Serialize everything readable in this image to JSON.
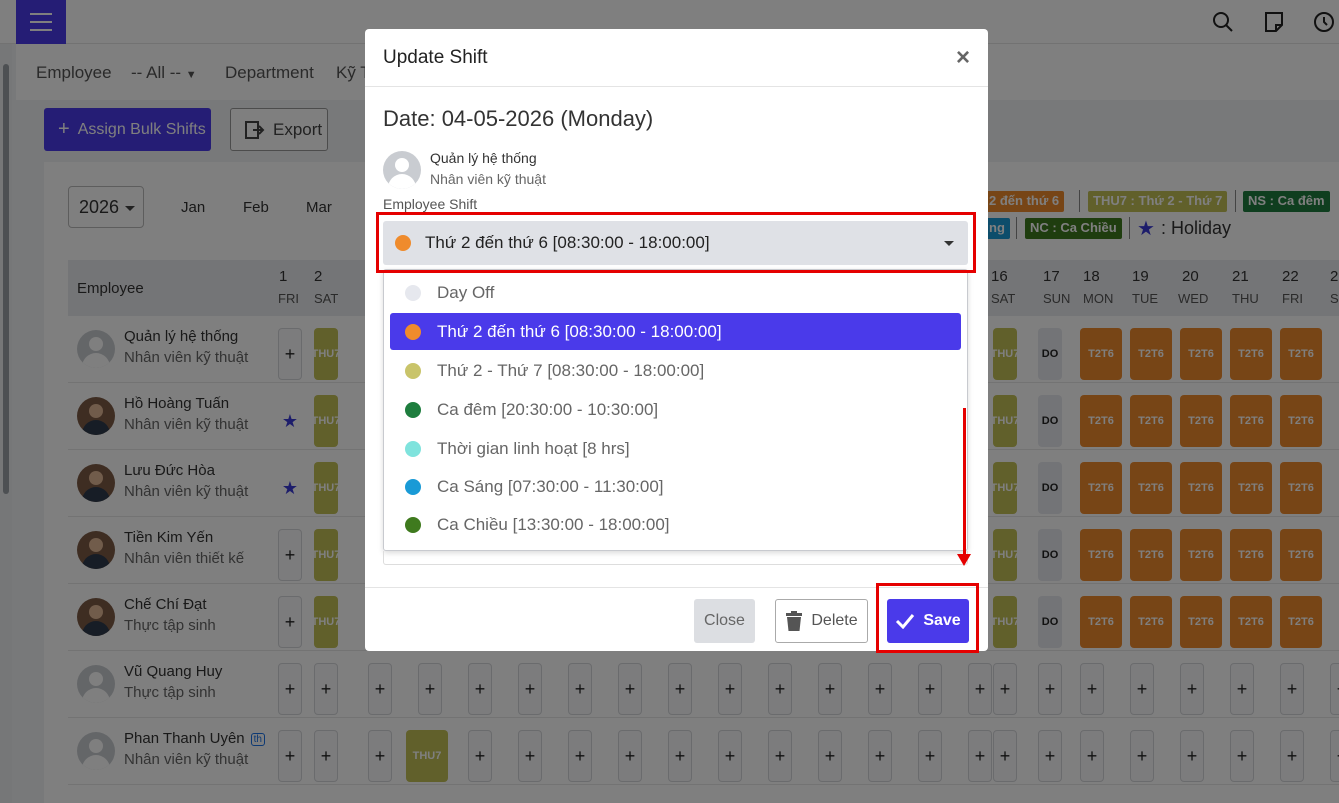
{
  "topbar": {
    "icons": [
      "menu-icon",
      "search-icon",
      "note-icon",
      "clock-icon"
    ]
  },
  "filters": {
    "employee_label": "Employee",
    "employee_value": "-- All --",
    "department_label": "Department",
    "department_value": "Kỹ T"
  },
  "toolbar": {
    "bulk_label": "Assign Bulk Shifts",
    "export_label": "Export"
  },
  "calendar": {
    "year": "2026",
    "months": [
      "Jan",
      "Feb",
      "Mar"
    ],
    "legend": [
      {
        "label": "2 đến thứ 6",
        "color": "#ef8b2c"
      },
      {
        "label": "THU7 : Thứ 2 - Thứ 7",
        "color": "#c2c056"
      },
      {
        "label": "NS : Ca đêm",
        "color": "#1e7d3e"
      },
      {
        "label": "ng",
        "color": "#1a9ad6"
      },
      {
        "label": "NC : Ca Chiều",
        "color": "#3f7a1e"
      }
    ],
    "holiday_label": ": Holiday",
    "employee_header": "Employee",
    "left_days": [
      {
        "num": "1",
        "wd": "FRI"
      },
      {
        "num": "2",
        "wd": "SAT"
      }
    ],
    "right_days": [
      {
        "num": "16",
        "wd": "SAT"
      },
      {
        "num": "17",
        "wd": "SUN"
      },
      {
        "num": "18",
        "wd": "MON"
      },
      {
        "num": "19",
        "wd": "TUE"
      },
      {
        "num": "20",
        "wd": "WED"
      },
      {
        "num": "21",
        "wd": "THU"
      },
      {
        "num": "22",
        "wd": "FRI"
      },
      {
        "num": "2",
        "wd": "S"
      }
    ],
    "shift_codes": {
      "thu7": "THU7",
      "t2t6": "T2T6",
      "do": "DO",
      "add": "+"
    },
    "employees": [
      {
        "name": "Quản lý hệ thống",
        "role": "Nhân viên kỹ thuật"
      },
      {
        "name": "Hồ Hoàng Tuấn",
        "role": "Nhân viên kỹ thuật"
      },
      {
        "name": "Lưu Đức Hòa",
        "role": "Nhân viên kỹ thuật"
      },
      {
        "name": "Tiền Kim Yến",
        "role": "Nhân viên thiết kế"
      },
      {
        "name": "Chế Chí Đạt",
        "role": "Thực tập sinh"
      },
      {
        "name": "Vũ Quang Huy",
        "role": "Thực tập sinh"
      },
      {
        "name": "Phan Thanh Uyên",
        "role": "Nhân viên kỹ thuật",
        "badge": "th"
      }
    ]
  },
  "modal": {
    "title": "Update Shift",
    "close_icon": "×",
    "date_line": "Date: 04-05-2026 (Monday)",
    "employee_name": "Quản lý hệ thống",
    "employee_role": "Nhân viên kỹ thuật",
    "field_label": "Employee Shift",
    "selected_value": "Thứ 2 đến thứ 6 [08:30:00 - 18:00:00]",
    "selected_color": "#ef8b2c",
    "options": [
      {
        "label": "Day Off",
        "color": "#e6e8ee"
      },
      {
        "label": "Thứ 2 đến thứ 6 [08:30:00 - 18:00:00]",
        "color": "#ef8b2c",
        "selected": true
      },
      {
        "label": "Thứ 2 - Thứ 7 [08:30:00 - 18:00:00]",
        "color": "#c9c46a"
      },
      {
        "label": "Ca đêm [20:30:00 - 10:30:00]",
        "color": "#1e7d3e"
      },
      {
        "label": "Thời gian linh hoạt [8 hrs]",
        "color": "#7fe3dd"
      },
      {
        "label": "Ca Sáng [07:30:00 - 11:30:00]",
        "color": "#1a9ad6"
      },
      {
        "label": "Ca Chiều [13:30:00 - 18:00:00]",
        "color": "#3f7a1e"
      }
    ],
    "buttons": {
      "close": "Close",
      "delete": "Delete",
      "save": "Save"
    }
  },
  "colors": {
    "accent": "#4a3aea",
    "annotation": "#e50000"
  }
}
